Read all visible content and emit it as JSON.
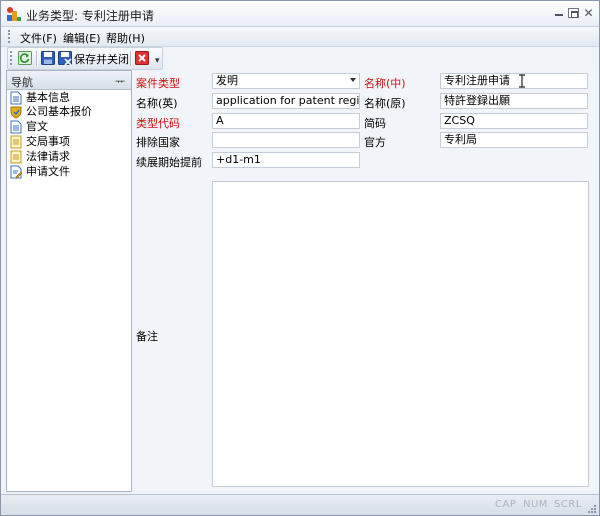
{
  "window": {
    "title": "业务类型: 专利注册申请"
  },
  "menubar": {
    "items": [
      "文件(F)",
      "编辑(E)",
      "帮助(H)"
    ]
  },
  "toolbar": {
    "refresh_icon": "refresh-icon",
    "save_icon": "save-icon",
    "save_close_label": "保存并关闭",
    "delete_icon": "delete-icon"
  },
  "nav": {
    "title": "导航",
    "pin": "ᅲ",
    "items": [
      {
        "label": "基本信息",
        "icon": "document-icon"
      },
      {
        "label": "公司基本报价",
        "icon": "shield-icon"
      },
      {
        "label": "官文",
        "icon": "document-icon"
      },
      {
        "label": "交局事项",
        "icon": "notepad-icon"
      },
      {
        "label": "法律请求",
        "icon": "notepad-icon"
      },
      {
        "label": "申请文件",
        "icon": "document-edit-icon"
      }
    ]
  },
  "form": {
    "case_type": {
      "label": "案件类型",
      "value": "发明"
    },
    "name_cn": {
      "label": "名称(中)",
      "value": "专利注册申请"
    },
    "name_en": {
      "label": "名称(英)",
      "value": "application for patent registrat"
    },
    "name_orig": {
      "label": "名称(原)",
      "value": "特許登録出願"
    },
    "type_code": {
      "label": "类型代码",
      "value": "A"
    },
    "short_code": {
      "label": "简码",
      "value": "ZCSQ"
    },
    "excluded_countries": {
      "label": "排除国家",
      "value": ""
    },
    "office": {
      "label": "官方",
      "value": "专利局"
    },
    "extension_start": {
      "label": "续展期始提前",
      "value": "+d1-m1"
    },
    "remarks": {
      "label": "备注",
      "value": ""
    }
  },
  "statusbar": {
    "cap": "CAP",
    "num": "NUM",
    "scrl": "SCRL"
  },
  "colors": {
    "required_label": "#d01010",
    "accent": "#1f5fbf"
  }
}
